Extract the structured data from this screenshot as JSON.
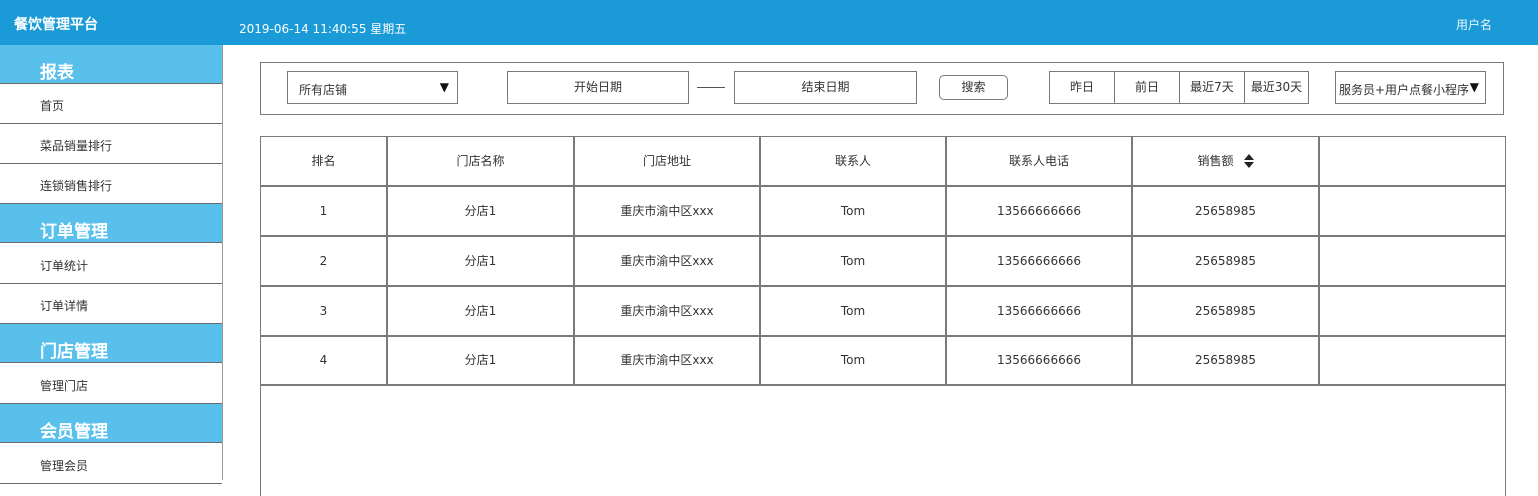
{
  "header": {
    "brand": "餐饮管理平台",
    "datetime": "2019-06-14 11:40:55 星期五",
    "username": "用户名"
  },
  "sidebar": {
    "sections": [
      {
        "title": "报表",
        "items": [
          "首页",
          "菜品销量排行",
          "连锁销售排行"
        ]
      },
      {
        "title": "订单管理",
        "items": [
          "订单统计",
          "订单详情"
        ]
      },
      {
        "title": "门店管理",
        "items": [
          "管理门店"
        ]
      },
      {
        "title": "会员管理",
        "items": [
          "管理会员"
        ]
      }
    ]
  },
  "filters": {
    "store_select": "所有店铺",
    "start_date_placeholder": "开始日期",
    "end_date_placeholder": "结束日期",
    "search_label": "搜索",
    "quick_ranges": [
      "昨日",
      "前日",
      "最近7天",
      "最近30天"
    ],
    "channel_select": "服务员+用户点餐小程序"
  },
  "table": {
    "columns": [
      "排名",
      "门店名称",
      "门店地址",
      "联系人",
      "联系人电话",
      "销售额",
      ""
    ],
    "rows": [
      [
        "1",
        "分店1",
        "重庆市渝中区xxx",
        "Tom",
        "13566666666",
        "25658985",
        ""
      ],
      [
        "2",
        "分店1",
        "重庆市渝中区xxx",
        "Tom",
        "13566666666",
        "25658985",
        ""
      ],
      [
        "3",
        "分店1",
        "重庆市渝中区xxx",
        "Tom",
        "13566666666",
        "25658985",
        ""
      ],
      [
        "4",
        "分店1",
        "重庆市渝中区xxx",
        "Tom",
        "13566666666",
        "25658985",
        ""
      ]
    ]
  },
  "icons": {
    "sort": "sort-icon",
    "dropdown": "triangle-down-icon"
  },
  "colors": {
    "header": "#1a9bd7",
    "sidebar_section": "#59bfeb"
  }
}
